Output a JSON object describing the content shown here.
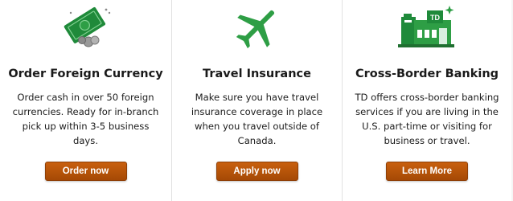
{
  "colors": {
    "td_green": "#2e9e45",
    "button_orange": "#b8560b",
    "button_text": "#ffffff"
  },
  "cards": [
    {
      "icon": "cash-icon",
      "title": "Order Foreign Currency",
      "description": "Order cash in over 50 foreign currencies. Ready for in-branch pick up within 3-5 business days.",
      "button": "Order now"
    },
    {
      "icon": "airplane-icon",
      "title": "Travel Insurance",
      "description": "Make sure you have travel insurance coverage in place when you travel outside of Canada.",
      "button": "Apply now"
    },
    {
      "icon": "bank-branch-icon",
      "icon_text": "TD",
      "title": "Cross-Border Banking",
      "description": "TD offers cross-border banking services if you are living in the U.S. part-time or visiting for business or travel.",
      "button": "Learn More"
    }
  ]
}
